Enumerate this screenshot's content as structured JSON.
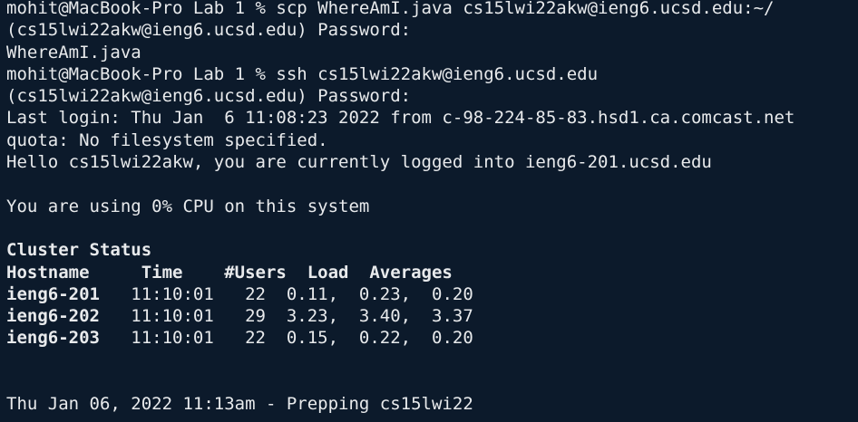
{
  "terminal": {
    "lines": [
      {
        "text": "mohit@MacBook-Pro Lab 1 % scp WhereAmI.java cs15lwi22akw@ieng6.ucsd.edu:~/",
        "bold": false
      },
      {
        "text": "(cs15lwi22akw@ieng6.ucsd.edu) Password:",
        "bold": false
      },
      {
        "text": "WhereAmI.java",
        "bold": false
      },
      {
        "text": "mohit@MacBook-Pro Lab 1 % ssh cs15lwi22akw@ieng6.ucsd.edu",
        "bold": false
      },
      {
        "text": "(cs15lwi22akw@ieng6.ucsd.edu) Password:",
        "bold": false
      },
      {
        "text": "Last login: Thu Jan  6 11:08:23 2022 from c-98-224-85-83.hsd1.ca.comcast.net",
        "bold": false
      },
      {
        "text": "quota: No filesystem specified.",
        "bold": false
      },
      {
        "text": "Hello cs15lwi22akw, you are currently logged into ieng6-201.ucsd.edu",
        "bold": false
      },
      {
        "text": "",
        "bold": false
      },
      {
        "text": "You are using 0% CPU on this system",
        "bold": false
      },
      {
        "text": "",
        "bold": false
      },
      {
        "text": "Cluster Status",
        "bold": true
      },
      {
        "text": "Hostname     Time    #Users  Load  Averages",
        "bold": true
      },
      {
        "text": "ieng6-201   11:10:01   22  0.11,  0.23,  0.20",
        "bold": false,
        "host": "ieng6-201",
        "rest": "   11:10:01   22  0.11,  0.23,  0.20"
      },
      {
        "text": "ieng6-202   11:10:01   29  3.23,  3.40,  3.37",
        "bold": false,
        "host": "ieng6-202",
        "rest": "   11:10:01   29  3.23,  3.40,  3.37"
      },
      {
        "text": "ieng6-203   11:10:01   22  0.15,  0.22,  0.20",
        "bold": false,
        "host": "ieng6-203",
        "rest": "   11:10:01   22  0.15,  0.22,  0.20"
      },
      {
        "text": "",
        "bold": false
      },
      {
        "text": "",
        "bold": false
      },
      {
        "text": "Thu Jan 06, 2022 11:13am - Prepping cs15lwi22",
        "bold": false
      }
    ]
  },
  "colors": {
    "background": "#0c1a2b",
    "foreground": "#e8eaec"
  }
}
